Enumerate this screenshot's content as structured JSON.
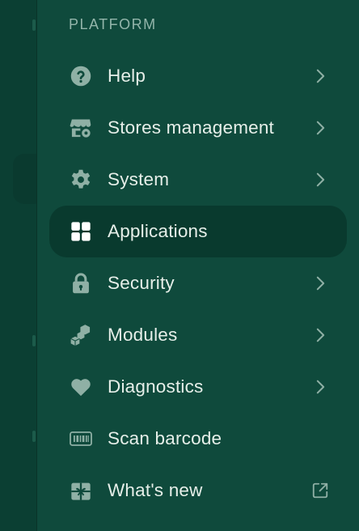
{
  "section": {
    "title": "PLATFORM"
  },
  "colors": {
    "panel_bg": "#0f4a3c",
    "active_bg": "#093a2e",
    "icon": "#8fb0a5",
    "text": "#e6efe9"
  },
  "menu": {
    "items": [
      {
        "label": "Help",
        "icon": "help-icon",
        "trailing": "chevron"
      },
      {
        "label": "Stores management",
        "icon": "store-settings-icon",
        "trailing": "chevron"
      },
      {
        "label": "System",
        "icon": "gear-icon",
        "trailing": "chevron"
      },
      {
        "label": "Applications",
        "icon": "grid-icon",
        "trailing": "none",
        "active": true
      },
      {
        "label": "Security",
        "icon": "lock-icon",
        "trailing": "chevron"
      },
      {
        "label": "Modules",
        "icon": "cubes-icon",
        "trailing": "chevron"
      },
      {
        "label": "Diagnostics",
        "icon": "heart-icon",
        "trailing": "chevron"
      },
      {
        "label": "Scan barcode",
        "icon": "barcode-icon",
        "trailing": "none"
      },
      {
        "label": "What's new",
        "icon": "gift-icon",
        "trailing": "external"
      }
    ]
  }
}
